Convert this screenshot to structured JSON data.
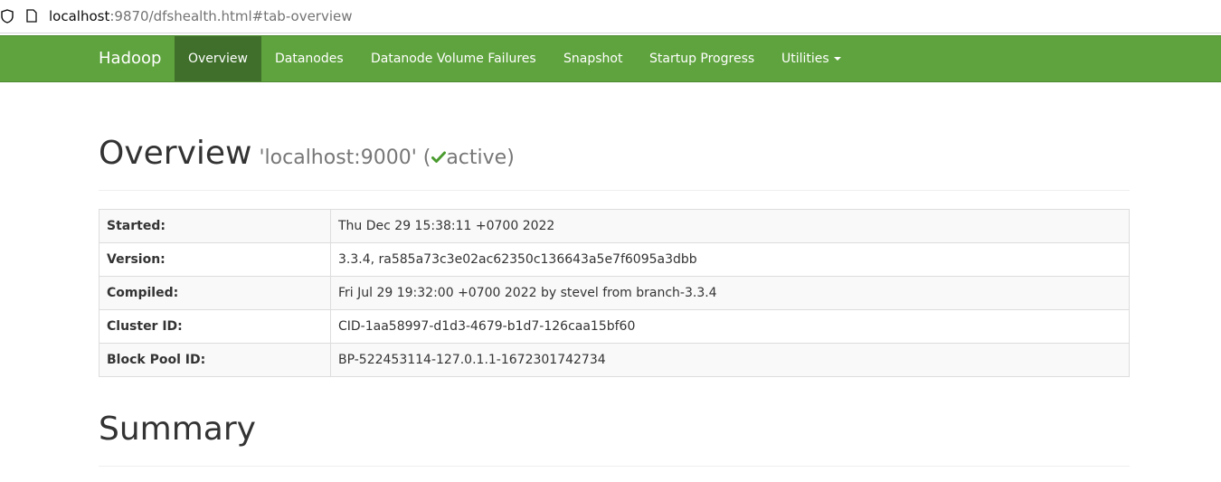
{
  "browser": {
    "url_host": "localhost",
    "url_rest": ":9870/dfshealth.html#tab-overview"
  },
  "navbar": {
    "brand": "Hadoop",
    "items": [
      {
        "label": "Overview",
        "active": true
      },
      {
        "label": "Datanodes"
      },
      {
        "label": "Datanode Volume Failures"
      },
      {
        "label": "Snapshot"
      },
      {
        "label": "Startup Progress"
      },
      {
        "label": "Utilities"
      }
    ]
  },
  "overview": {
    "title": "Overview",
    "host": "'localhost:9000' (",
    "state": "active",
    "close": ")",
    "rows": [
      {
        "label": "Started:",
        "value": "Thu Dec 29 15:38:11 +0700 2022"
      },
      {
        "label": "Version:",
        "value": "3.3.4, ra585a73c3e02ac62350c136643a5e7f6095a3dbb"
      },
      {
        "label": "Compiled:",
        "value": "Fri Jul 29 19:32:00 +0700 2022 by stevel from branch-3.3.4"
      },
      {
        "label": "Cluster ID:",
        "value": "CID-1aa58997-d1d3-4679-b1d7-126caa15bf60"
      },
      {
        "label": "Block Pool ID:",
        "value": "BP-522453114-127.0.1.1-1672301742734"
      }
    ]
  },
  "summary": {
    "title": "Summary"
  },
  "colors": {
    "navbar": "#5fa33e",
    "navbar_active": "#3f6f2a",
    "check": "#4a9b2f"
  },
  "icons": {
    "shield": "shield-icon",
    "page": "page-icon",
    "check": "check-icon",
    "caret": "caret-down-icon"
  }
}
